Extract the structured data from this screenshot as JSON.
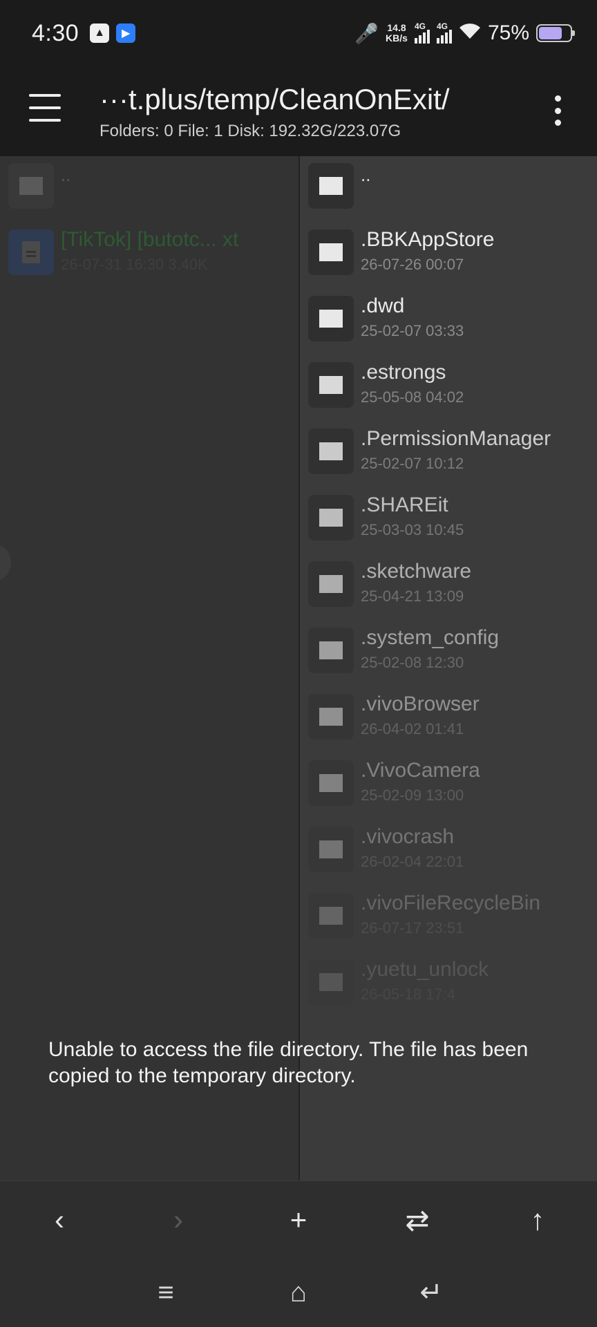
{
  "status_bar": {
    "time": "4:30",
    "net_speed_value": "14.8",
    "net_speed_unit": "KB/s",
    "sim1_label": "4G",
    "sim2_label": "4G",
    "battery_percent": "75%",
    "battery_level": 0.75
  },
  "toolbar": {
    "path": "···t.plus/temp/CleanOnExit/",
    "info": "Folders: 0  File: 1  Disk: 192.32G/223.07G"
  },
  "left_pane": {
    "parent_label": "..",
    "items": [
      {
        "name": "[TikTok] [butotc... xt",
        "meta": "26-07-31 16:30  3.40K",
        "type": "file"
      }
    ]
  },
  "right_pane": {
    "parent_label": "..",
    "items": [
      {
        "name": ".BBKAppStore",
        "meta": "26-07-26 00:07"
      },
      {
        "name": ".dwd",
        "meta": "25-02-07 03:33"
      },
      {
        "name": ".estrongs",
        "meta": "25-05-08 04:02"
      },
      {
        "name": ".PermissionManager",
        "meta": "25-02-07 10:12"
      },
      {
        "name": ".SHAREit",
        "meta": "25-03-03 10:45"
      },
      {
        "name": ".sketchware",
        "meta": "25-04-21 13:09"
      },
      {
        "name": ".system_config",
        "meta": "25-02-08 12:30"
      },
      {
        "name": ".vivoBrowser",
        "meta": "26-04-02 01:41"
      },
      {
        "name": ".VivoCamera",
        "meta": "25-02-09 13:00"
      },
      {
        "name": ".vivocrash",
        "meta": "26-02-04 22:01"
      },
      {
        "name": ".vivoFileRecycleBin",
        "meta": "26-07-17 23:51"
      },
      {
        "name": ".yuetu_unlock",
        "meta": "26-05-18 17:4"
      }
    ]
  },
  "toast": {
    "message": "Unable to access the file directory. The file has been copied to the temporary directory."
  },
  "bottom_bar": {
    "back_icon": "‹",
    "forward_icon": "›",
    "add_icon": "+",
    "swap_icon": "⇄",
    "up_icon": "↑"
  },
  "nav_bar": {
    "menu_icon": "≡",
    "home_icon": "⌂",
    "back_icon": "↵"
  },
  "colors": {
    "folder": "#e8e8e8",
    "left_file_name": "#2e5a33",
    "left_file_meta": "#3f3f3f",
    "right_name_top": "#ececec",
    "right_meta": "#8a8a8a"
  }
}
